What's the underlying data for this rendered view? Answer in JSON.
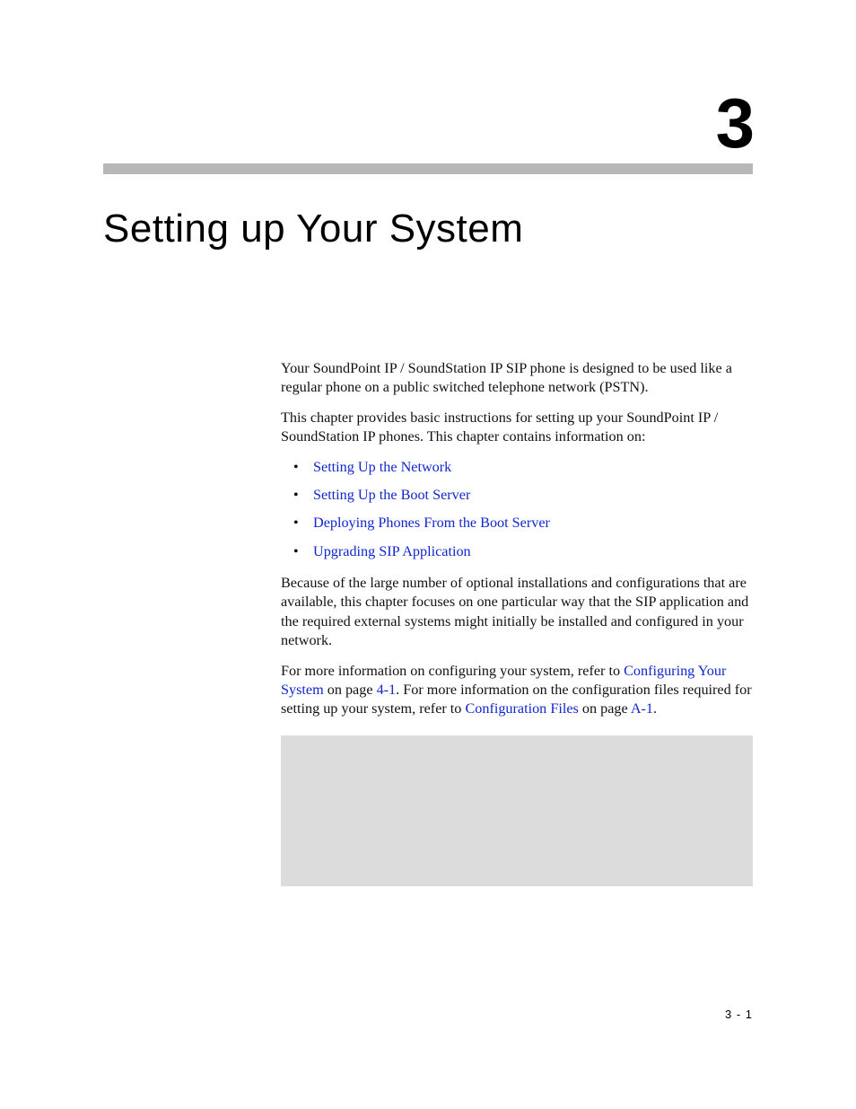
{
  "chapter_number": "3",
  "title": "Setting up Your System",
  "paragraphs": {
    "p1": "Your SoundPoint IP / SoundStation IP SIP phone is designed to be used like a regular phone on a public switched telephone network (PSTN).",
    "p2": "This chapter provides basic instructions for setting up your SoundPoint IP / SoundStation IP phones. This chapter contains information on:",
    "p3": "Because of the large number of optional installations and configurations that are available, this chapter focuses on one particular way that the SIP application and the required external systems might initially be installed and configured in your network.",
    "p4_a": "For more information on configuring your system, refer to ",
    "p4_link1": "Configuring Your System",
    "p4_b": " on page ",
    "p4_page1": "4-1",
    "p4_c": ". For more information on the configuration files required for setting up your system, refer to ",
    "p4_link2": "Configuration Files",
    "p4_d": " on page ",
    "p4_page2": "A-1",
    "p4_e": "."
  },
  "bullets": [
    "Setting Up the Network",
    "Setting Up the Boot Server",
    "Deploying Phones From the Boot Server",
    "Upgrading SIP Application"
  ],
  "page_footer": "3 - 1"
}
